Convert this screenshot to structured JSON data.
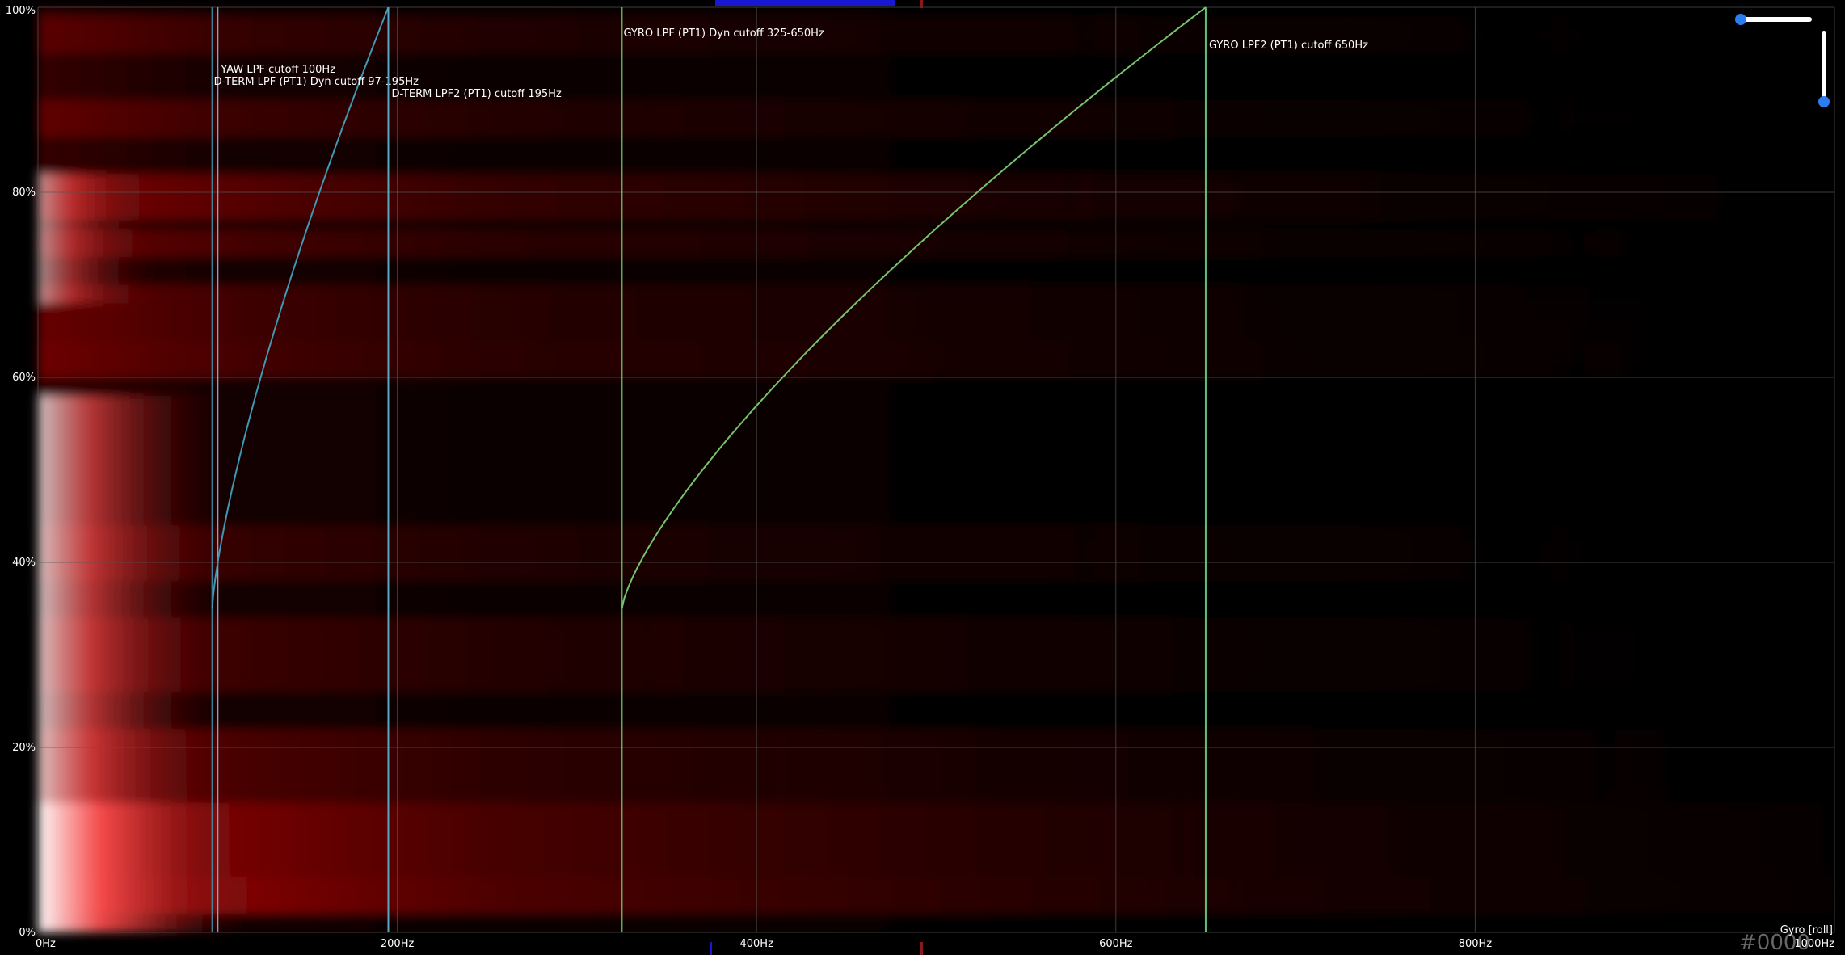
{
  "chart_data": {
    "type": "heatmap",
    "title": "",
    "series_label": "Gyro [roll]",
    "x_axis": {
      "unit": "Hz",
      "range": [
        0,
        1000
      ],
      "ticks": [
        0,
        200,
        400,
        600,
        800,
        1000
      ],
      "tick_labels": [
        "0Hz",
        "200Hz",
        "400Hz",
        "600Hz",
        "800Hz",
        "1000Hz"
      ]
    },
    "y_axis": {
      "unit": "% throttle",
      "range": [
        0,
        100
      ],
      "ticks": [
        0,
        20,
        40,
        60,
        80,
        100
      ],
      "tick_labels": [
        "0%",
        "20%",
        "40%",
        "60%",
        "80%",
        "100%"
      ]
    },
    "grid": true,
    "watermark": "#0000",
    "filters": [
      {
        "name": "YAW LPF cutoff 100Hz",
        "kind": "static",
        "cutoff_hz": 100,
        "color": "#7fa8c8"
      },
      {
        "name": "D-TERM LPF (PT1) Dyn cutoff 97-195Hz",
        "kind": "dynamic",
        "min_hz": 97,
        "max_hz": 195,
        "color": "#3f98b4"
      },
      {
        "name": "D-TERM LPF2 (PT1) cutoff 195Hz",
        "kind": "static",
        "cutoff_hz": 195,
        "color": "#5aa8c0"
      },
      {
        "name": "GYRO LPF (PT1) Dyn cutoff 325-650Hz",
        "kind": "dynamic",
        "min_hz": 325,
        "max_hz": 650,
        "color": "#74c46c"
      },
      {
        "name": "GYRO LPF2 (PT1) cutoff 650Hz",
        "kind": "static",
        "cutoff_hz": 650,
        "color": "#5fc07a"
      }
    ],
    "dynamic_curve_start_pct": 35,
    "colors": {
      "background": "#050000",
      "low_energy": "#2a0000",
      "mid_energy": "#b00000",
      "high_energy": "#ffffff",
      "grid": "#555555",
      "text": "#ffffff"
    }
  }
}
